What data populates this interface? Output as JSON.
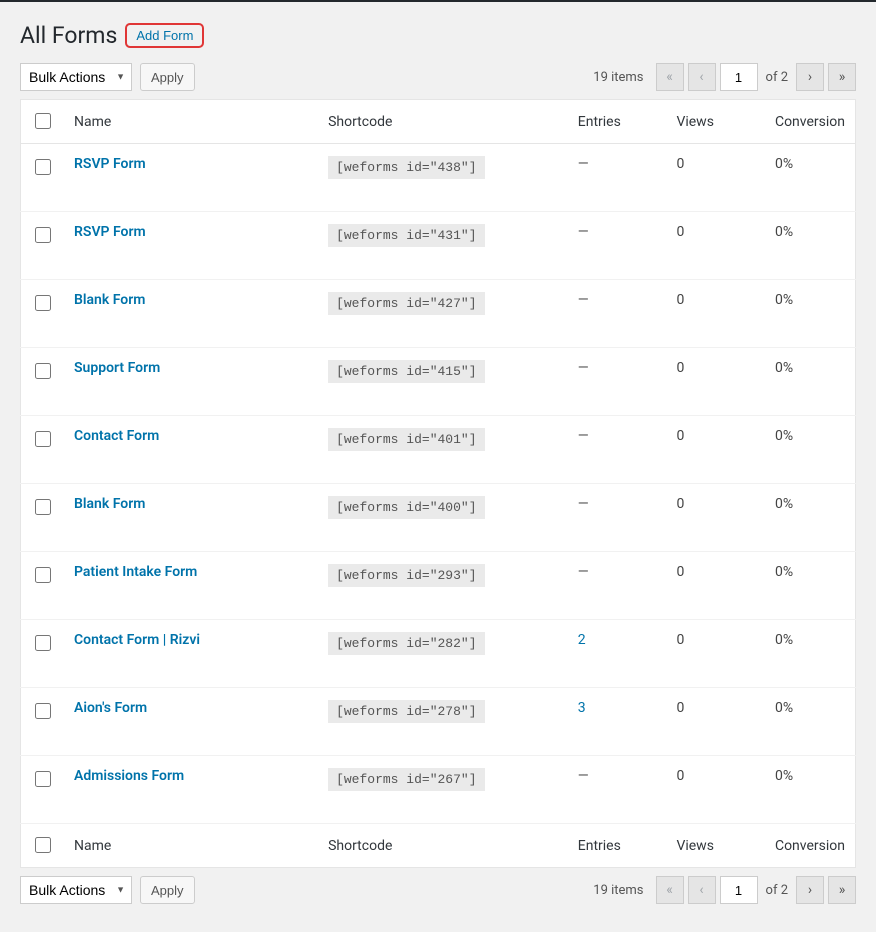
{
  "header": {
    "title": "All Forms",
    "add_button": "Add Form"
  },
  "bulk": {
    "label": "Bulk Actions",
    "apply": "Apply"
  },
  "pagination": {
    "items_text": "19 items",
    "current": "1",
    "of_text": "of 2"
  },
  "columns": {
    "name": "Name",
    "shortcode": "Shortcode",
    "entries": "Entries",
    "views": "Views",
    "conversion": "Conversion"
  },
  "rows": [
    {
      "name": "RSVP Form",
      "shortcode": "[weforms id=\"438\"]",
      "entries": "—",
      "entries_link": false,
      "views": "0",
      "conversion": "0%"
    },
    {
      "name": "RSVP Form",
      "shortcode": "[weforms id=\"431\"]",
      "entries": "—",
      "entries_link": false,
      "views": "0",
      "conversion": "0%"
    },
    {
      "name": "Blank Form",
      "shortcode": "[weforms id=\"427\"]",
      "entries": "—",
      "entries_link": false,
      "views": "0",
      "conversion": "0%"
    },
    {
      "name": "Support Form",
      "shortcode": "[weforms id=\"415\"]",
      "entries": "—",
      "entries_link": false,
      "views": "0",
      "conversion": "0%"
    },
    {
      "name": "Contact Form",
      "shortcode": "[weforms id=\"401\"]",
      "entries": "—",
      "entries_link": false,
      "views": "0",
      "conversion": "0%"
    },
    {
      "name": "Blank Form",
      "shortcode": "[weforms id=\"400\"]",
      "entries": "—",
      "entries_link": false,
      "views": "0",
      "conversion": "0%"
    },
    {
      "name": "Patient Intake Form",
      "shortcode": "[weforms id=\"293\"]",
      "entries": "—",
      "entries_link": false,
      "views": "0",
      "conversion": "0%"
    },
    {
      "name": "Contact Form | Rizvi",
      "shortcode": "[weforms id=\"282\"]",
      "entries": "2",
      "entries_link": true,
      "views": "0",
      "conversion": "0%"
    },
    {
      "name": "Aion's Form",
      "shortcode": "[weforms id=\"278\"]",
      "entries": "3",
      "entries_link": true,
      "views": "0",
      "conversion": "0%"
    },
    {
      "name": "Admissions Form",
      "shortcode": "[weforms id=\"267\"]",
      "entries": "—",
      "entries_link": false,
      "views": "0",
      "conversion": "0%"
    }
  ]
}
